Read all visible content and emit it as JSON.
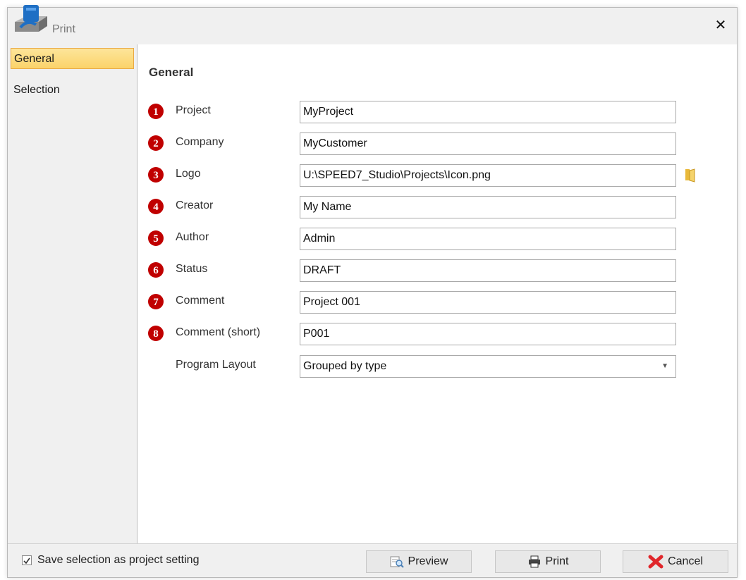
{
  "window": {
    "title": "Print",
    "close_glyph": "✕"
  },
  "sidebar": {
    "items": [
      {
        "label": "General",
        "active": true
      },
      {
        "label": "Selection",
        "active": false
      }
    ]
  },
  "main": {
    "section_title": "General",
    "fields": [
      {
        "number": "1",
        "label": "Project",
        "value": "MyProject"
      },
      {
        "number": "2",
        "label": "Company",
        "value": "MyCustomer"
      },
      {
        "number": "3",
        "label": "Logo",
        "value": "U:\\SPEED7_Studio\\Projects\\Icon.png"
      },
      {
        "number": "4",
        "label": "Creator",
        "value": "My Name"
      },
      {
        "number": "5",
        "label": "Author",
        "value": "Admin"
      },
      {
        "number": "6",
        "label": "Status",
        "value": "DRAFT"
      },
      {
        "number": "7",
        "label": "Comment",
        "value": "Project 001"
      },
      {
        "number": "8",
        "label": "Comment (short)",
        "value": "P001"
      }
    ],
    "program_layout": {
      "label": "Program Layout",
      "value": "Grouped by type"
    }
  },
  "footer": {
    "save_setting_label": "Save selection as project setting",
    "save_setting_checked": true,
    "preview_label": "Preview",
    "print_label": "Print",
    "cancel_label": "Cancel"
  },
  "colors": {
    "marker": "#c00000",
    "active_item": "#fbd36a",
    "cancel_x": "#e0262b"
  }
}
